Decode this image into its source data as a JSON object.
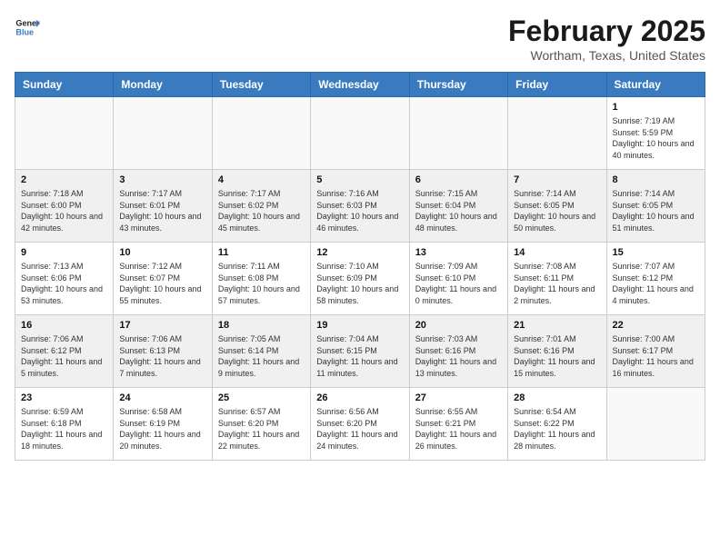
{
  "header": {
    "logo_line1": "General",
    "logo_line2": "Blue",
    "month": "February 2025",
    "location": "Wortham, Texas, United States"
  },
  "weekdays": [
    "Sunday",
    "Monday",
    "Tuesday",
    "Wednesday",
    "Thursday",
    "Friday",
    "Saturday"
  ],
  "weeks": [
    [
      {
        "day": "",
        "info": ""
      },
      {
        "day": "",
        "info": ""
      },
      {
        "day": "",
        "info": ""
      },
      {
        "day": "",
        "info": ""
      },
      {
        "day": "",
        "info": ""
      },
      {
        "day": "",
        "info": ""
      },
      {
        "day": "1",
        "info": "Sunrise: 7:19 AM\nSunset: 5:59 PM\nDaylight: 10 hours and 40 minutes."
      }
    ],
    [
      {
        "day": "2",
        "info": "Sunrise: 7:18 AM\nSunset: 6:00 PM\nDaylight: 10 hours and 42 minutes."
      },
      {
        "day": "3",
        "info": "Sunrise: 7:17 AM\nSunset: 6:01 PM\nDaylight: 10 hours and 43 minutes."
      },
      {
        "day": "4",
        "info": "Sunrise: 7:17 AM\nSunset: 6:02 PM\nDaylight: 10 hours and 45 minutes."
      },
      {
        "day": "5",
        "info": "Sunrise: 7:16 AM\nSunset: 6:03 PM\nDaylight: 10 hours and 46 minutes."
      },
      {
        "day": "6",
        "info": "Sunrise: 7:15 AM\nSunset: 6:04 PM\nDaylight: 10 hours and 48 minutes."
      },
      {
        "day": "7",
        "info": "Sunrise: 7:14 AM\nSunset: 6:05 PM\nDaylight: 10 hours and 50 minutes."
      },
      {
        "day": "8",
        "info": "Sunrise: 7:14 AM\nSunset: 6:05 PM\nDaylight: 10 hours and 51 minutes."
      }
    ],
    [
      {
        "day": "9",
        "info": "Sunrise: 7:13 AM\nSunset: 6:06 PM\nDaylight: 10 hours and 53 minutes."
      },
      {
        "day": "10",
        "info": "Sunrise: 7:12 AM\nSunset: 6:07 PM\nDaylight: 10 hours and 55 minutes."
      },
      {
        "day": "11",
        "info": "Sunrise: 7:11 AM\nSunset: 6:08 PM\nDaylight: 10 hours and 57 minutes."
      },
      {
        "day": "12",
        "info": "Sunrise: 7:10 AM\nSunset: 6:09 PM\nDaylight: 10 hours and 58 minutes."
      },
      {
        "day": "13",
        "info": "Sunrise: 7:09 AM\nSunset: 6:10 PM\nDaylight: 11 hours and 0 minutes."
      },
      {
        "day": "14",
        "info": "Sunrise: 7:08 AM\nSunset: 6:11 PM\nDaylight: 11 hours and 2 minutes."
      },
      {
        "day": "15",
        "info": "Sunrise: 7:07 AM\nSunset: 6:12 PM\nDaylight: 11 hours and 4 minutes."
      }
    ],
    [
      {
        "day": "16",
        "info": "Sunrise: 7:06 AM\nSunset: 6:12 PM\nDaylight: 11 hours and 5 minutes."
      },
      {
        "day": "17",
        "info": "Sunrise: 7:06 AM\nSunset: 6:13 PM\nDaylight: 11 hours and 7 minutes."
      },
      {
        "day": "18",
        "info": "Sunrise: 7:05 AM\nSunset: 6:14 PM\nDaylight: 11 hours and 9 minutes."
      },
      {
        "day": "19",
        "info": "Sunrise: 7:04 AM\nSunset: 6:15 PM\nDaylight: 11 hours and 11 minutes."
      },
      {
        "day": "20",
        "info": "Sunrise: 7:03 AM\nSunset: 6:16 PM\nDaylight: 11 hours and 13 minutes."
      },
      {
        "day": "21",
        "info": "Sunrise: 7:01 AM\nSunset: 6:16 PM\nDaylight: 11 hours and 15 minutes."
      },
      {
        "day": "22",
        "info": "Sunrise: 7:00 AM\nSunset: 6:17 PM\nDaylight: 11 hours and 16 minutes."
      }
    ],
    [
      {
        "day": "23",
        "info": "Sunrise: 6:59 AM\nSunset: 6:18 PM\nDaylight: 11 hours and 18 minutes."
      },
      {
        "day": "24",
        "info": "Sunrise: 6:58 AM\nSunset: 6:19 PM\nDaylight: 11 hours and 20 minutes."
      },
      {
        "day": "25",
        "info": "Sunrise: 6:57 AM\nSunset: 6:20 PM\nDaylight: 11 hours and 22 minutes."
      },
      {
        "day": "26",
        "info": "Sunrise: 6:56 AM\nSunset: 6:20 PM\nDaylight: 11 hours and 24 minutes."
      },
      {
        "day": "27",
        "info": "Sunrise: 6:55 AM\nSunset: 6:21 PM\nDaylight: 11 hours and 26 minutes."
      },
      {
        "day": "28",
        "info": "Sunrise: 6:54 AM\nSunset: 6:22 PM\nDaylight: 11 hours and 28 minutes."
      },
      {
        "day": "",
        "info": ""
      }
    ]
  ]
}
